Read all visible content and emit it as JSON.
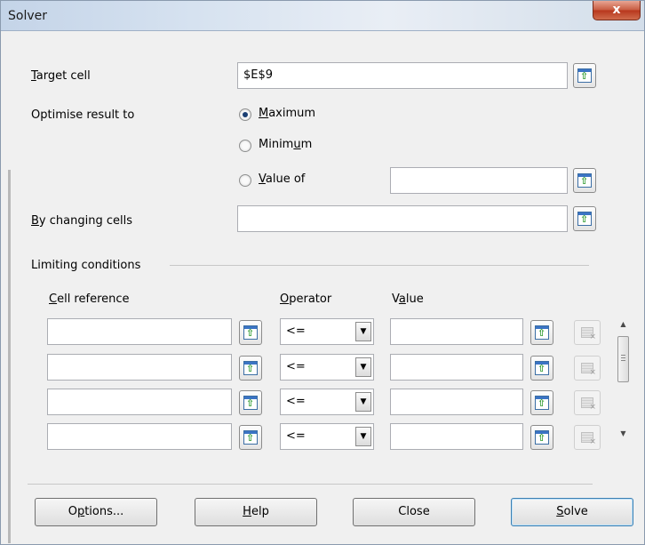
{
  "window": {
    "title": "Solver",
    "close_glyph": "x"
  },
  "target": {
    "label": "Target cell",
    "value": "$E$9"
  },
  "optimise": {
    "label": "Optimise result to",
    "options": [
      {
        "label": "Maximum",
        "selected": true
      },
      {
        "label": "Minimum",
        "selected": false
      },
      {
        "label": "Value of",
        "selected": false
      }
    ],
    "value_of": ""
  },
  "changing": {
    "label": "By changing cells",
    "value": ""
  },
  "limiting": {
    "title": "Limiting conditions",
    "headers": {
      "cell_reference": "Cell reference",
      "operator": "Operator",
      "value": "Value"
    },
    "rows": [
      {
        "cell": "",
        "operator": "<=",
        "value": ""
      },
      {
        "cell": "",
        "operator": "<=",
        "value": ""
      },
      {
        "cell": "",
        "operator": "<=",
        "value": ""
      },
      {
        "cell": "",
        "operator": "<=",
        "value": ""
      }
    ]
  },
  "buttons": {
    "options": "Options...",
    "help": "Help",
    "close": "Close",
    "solve": "Solve"
  },
  "icons": {
    "shrink": "shrink-dialog-icon",
    "delete": "delete-condition-icon",
    "dropdown": "chevron-down-icon"
  },
  "colors": {
    "title_gradient": "#c4d4e8",
    "close_button": "#c75a3f",
    "default_button_border": "#3c7fb1"
  }
}
